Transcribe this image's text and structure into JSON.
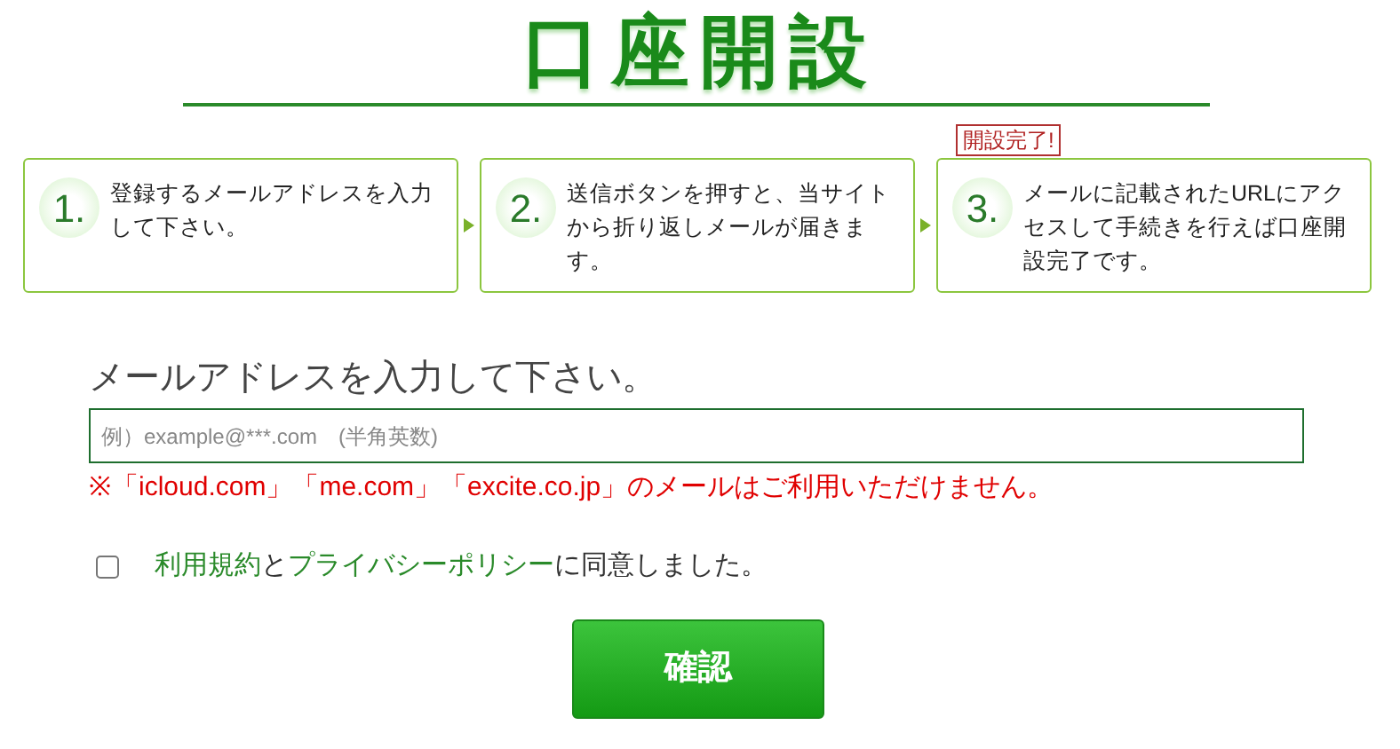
{
  "title": "口座開設",
  "steps": [
    {
      "number": "1.",
      "text": "登録するメールアドレスを入力して下さい。"
    },
    {
      "number": "2.",
      "text": "送信ボタンを押すと、当サイトから折り返しメールが届きます。"
    },
    {
      "number": "3.",
      "text": "メールに記載されたURLにアクセスして手続きを行えば口座開設完了です。",
      "badge": "開設完了!"
    }
  ],
  "email": {
    "label": "メールアドレスを入力して下さい。",
    "placeholder": "例）example@***.com　(半角英数)"
  },
  "note": "※「icloud.com」「me.com」「excite.co.jp」のメールはご利用いただけません。",
  "agreement": {
    "checked": false,
    "parts": [
      {
        "kind": "link",
        "text": "利用規約"
      },
      {
        "kind": "text",
        "text": "と"
      },
      {
        "kind": "link",
        "text": "プライバシーポリシー"
      },
      {
        "kind": "text",
        "text": "に同意しました。"
      }
    ]
  },
  "confirm_button": "確認"
}
